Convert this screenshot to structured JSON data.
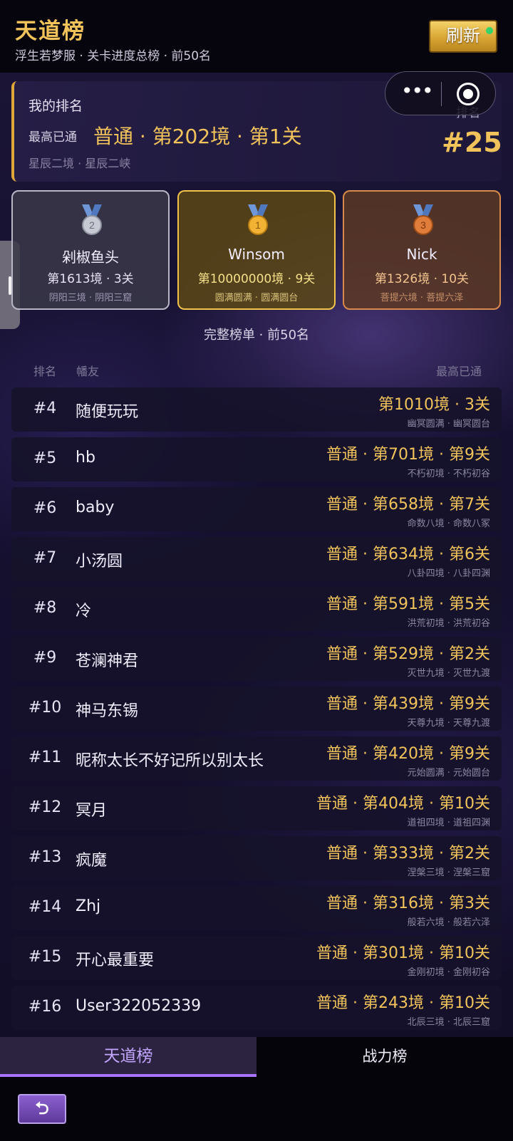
{
  "header": {
    "title": "天道榜",
    "subtitle": "浮生若梦服 · 关卡进度总榜 · 前50名",
    "refresh_label": "刷新"
  },
  "my_rank": {
    "label": "我的排名",
    "best_label": "最高已通",
    "best_value": "普通 · 第202境 · 第1关",
    "realm": "星辰二境 · 星辰二峡",
    "rank_label": "排名",
    "rank_value": "#25"
  },
  "podium": [
    {
      "place": "2",
      "name": "剁椒鱼头",
      "stage": "第1613境 · 3关",
      "realm": "阴阳三境 · 阴阳三窟"
    },
    {
      "place": "1",
      "name": "Winsom",
      "stage": "第10000000境 · 9关",
      "realm": "圆满圆满 · 圆满圆台"
    },
    {
      "place": "3",
      "name": "Nick",
      "stage": "第1326境 · 10关",
      "realm": "菩提六境 · 菩提六泽"
    }
  ],
  "list": {
    "title": "完整榜单 · 前50名",
    "col_rank": "排名",
    "col_name": "幡友",
    "col_best": "最高已通",
    "rows": [
      {
        "rank": "#4",
        "name": "随便玩玩",
        "stage": "第1010境 · 3关",
        "realm": "幽冥圆满 · 幽冥圆台"
      },
      {
        "rank": "#5",
        "name": "hb",
        "stage": "普通 · 第701境 · 第9关",
        "realm": "不朽初境 · 不朽初谷"
      },
      {
        "rank": "#6",
        "name": "baby",
        "stage": "普通 · 第658境 · 第7关",
        "realm": "命数八境 · 命数八冢"
      },
      {
        "rank": "#7",
        "name": "小汤圆",
        "stage": "普通 · 第634境 · 第6关",
        "realm": "八卦四境 · 八卦四渊"
      },
      {
        "rank": "#8",
        "name": "冷",
        "stage": "普通 · 第591境 · 第5关",
        "realm": "洪荒初境 · 洪荒初谷"
      },
      {
        "rank": "#9",
        "name": "苍澜神君",
        "stage": "普通 · 第529境 · 第2关",
        "realm": "灭世九境 · 灭世九渡"
      },
      {
        "rank": "#10",
        "name": "神马东锡",
        "stage": "普通 · 第439境 · 第9关",
        "realm": "天尊九境 · 天尊九渡"
      },
      {
        "rank": "#11",
        "name": "昵称太长不好记所以别太长",
        "stage": "普通 · 第420境 · 第9关",
        "realm": "元始圆满 · 元始圆台"
      },
      {
        "rank": "#12",
        "name": "冥月",
        "stage": "普通 · 第404境 · 第10关",
        "realm": "道祖四境 · 道祖四渊"
      },
      {
        "rank": "#13",
        "name": "疯魔",
        "stage": "普通 · 第333境 · 第2关",
        "realm": "涅槃三境 · 涅槃三窟"
      },
      {
        "rank": "#14",
        "name": "Zhj",
        "stage": "普通 · 第316境 · 第3关",
        "realm": "般若六境 · 般若六泽"
      },
      {
        "rank": "#15",
        "name": "开心最重要",
        "stage": "普通 · 第301境 · 第10关",
        "realm": "金刚初境 · 金刚初谷"
      },
      {
        "rank": "#16",
        "name": "User322052339",
        "stage": "普通 · 第243境 · 第10关",
        "realm": "北辰三境 · 北辰三窟"
      }
    ]
  },
  "tabs": [
    {
      "label": "天道榜"
    },
    {
      "label": "战力榜"
    }
  ],
  "colors": {
    "gold": "#f1c35a",
    "medal_gold": "#f2b233",
    "medal_silver": "#c7c9d3",
    "medal_bronze": "#e07d3a",
    "ribbon_blue": "#6f97d8",
    "tab_active": "#a874ff"
  },
  "icons": {
    "back": "back-arrow-icon",
    "more": "more-dots-icon",
    "target": "target-icon",
    "medal": "medal-icon"
  }
}
